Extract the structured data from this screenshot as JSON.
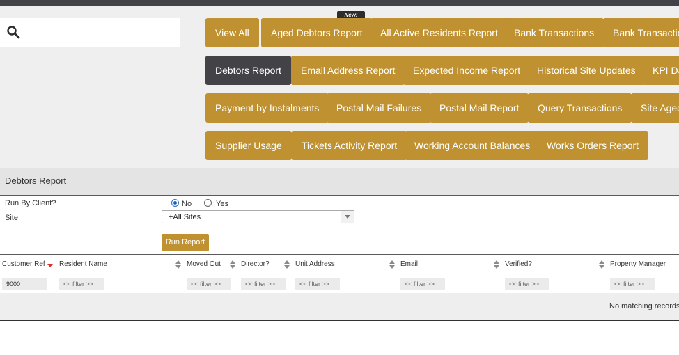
{
  "search": {
    "placeholder": ""
  },
  "reports": {
    "badge": "New!",
    "buttons": [
      "View All",
      "Aged Debtors Report",
      "All Active Residents Report",
      "Bank Transactions",
      "Bank Transactions",
      "Debtors Report",
      "Email Address Report",
      "Expected Income Report",
      "Historical Site Updates",
      "KPI Dashboard",
      "Payment by Instalments",
      "Postal Mail Failures",
      "Postal Mail Report",
      "Query Transactions",
      "Site Aged Debtors",
      "Supplier Usage",
      "Tickets Activity Report",
      "Working Account Balances",
      "Works Orders Report"
    ],
    "active": "Debtors Report"
  },
  "section": {
    "title": "Debtors Report"
  },
  "form": {
    "run_by_client_label": "Run By Client?",
    "radio_no": "No",
    "radio_yes": "Yes",
    "selected": "No",
    "site_label": "Site",
    "site_value": "+All Sites",
    "run_button": "Run Report"
  },
  "table": {
    "columns": [
      "Customer Ref",
      "Resident Name",
      "Moved Out",
      "Director?",
      "Unit Address",
      "Email",
      "Verified?",
      "Property Manager"
    ],
    "filters": [
      "9000",
      "<< filter >>",
      "<< filter >>",
      "<< filter >>",
      "<< filter >>",
      "<< filter >>",
      "<< filter >>",
      "<< filter >>"
    ],
    "empty_message": "No matching records found"
  },
  "colors": {
    "accent": "#bf9130",
    "active": "#434247",
    "topbar": "#434247"
  }
}
